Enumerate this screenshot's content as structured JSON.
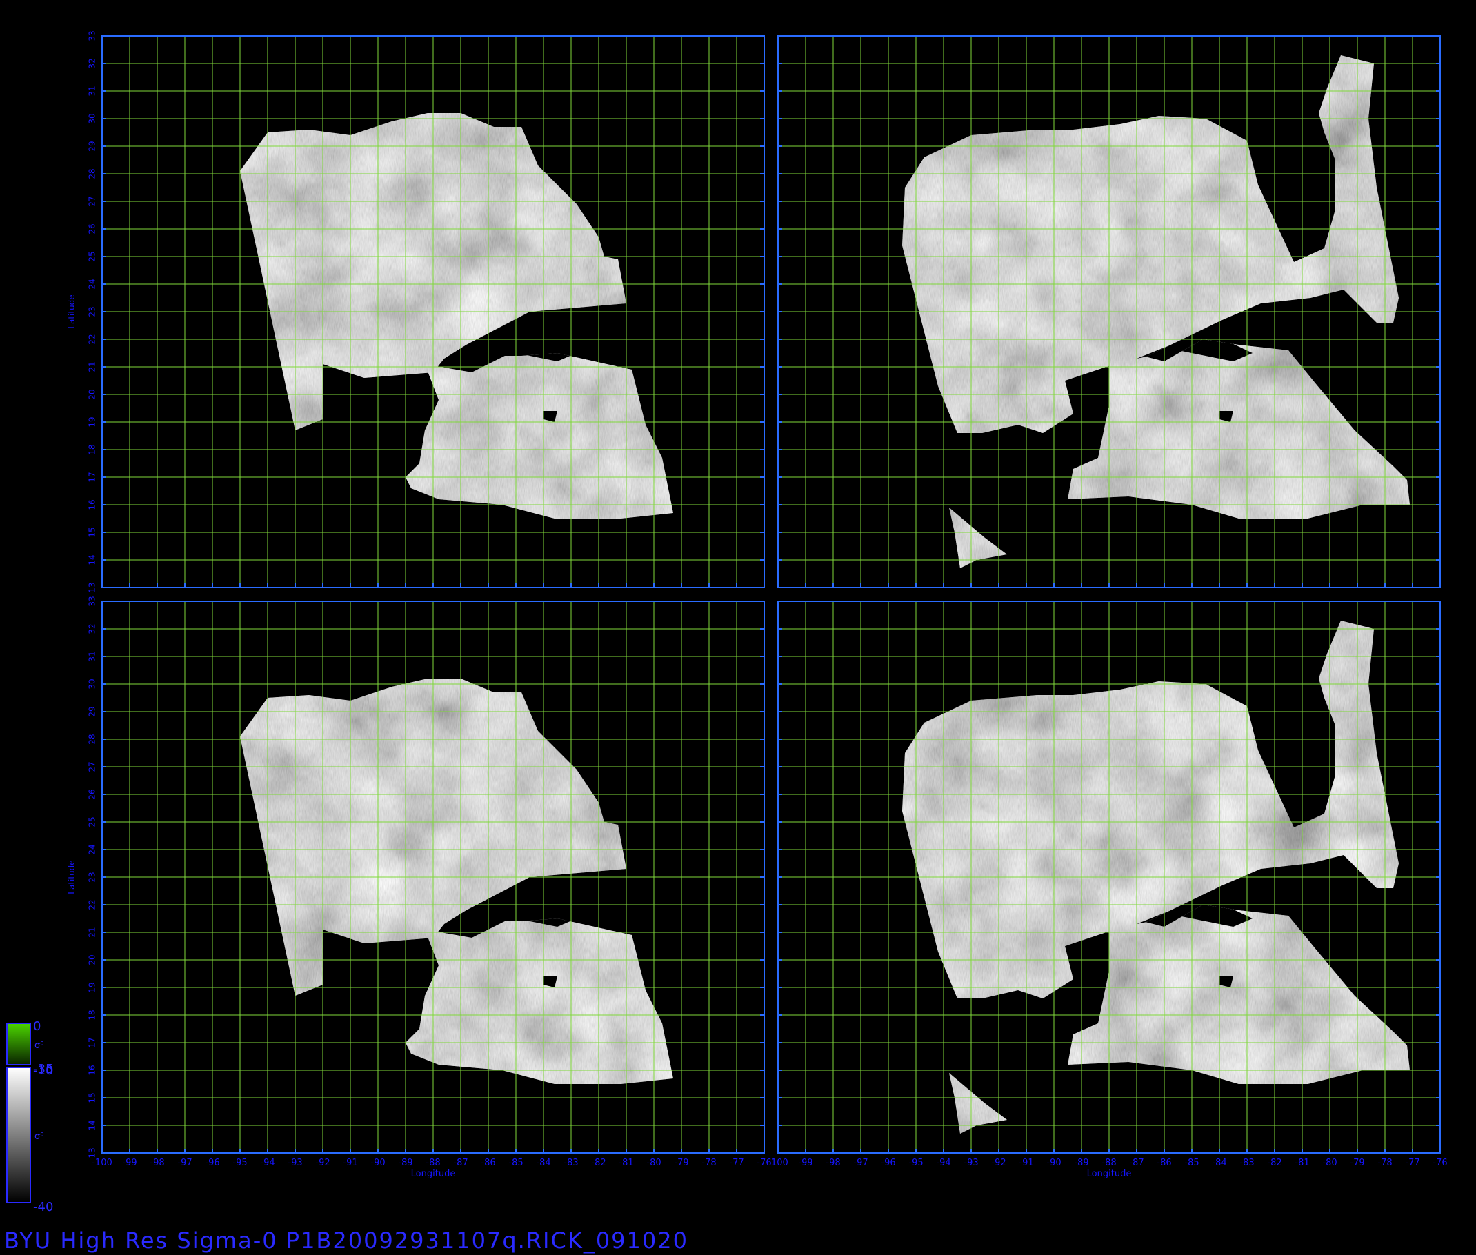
{
  "title": "BYU High Res Sigma-0 P1B20092931107q.RICK_091020",
  "axes": {
    "xlabel": "Longitude",
    "ylabel": "Latitude",
    "lon_range": [
      -100,
      -76
    ],
    "lat_range": [
      13,
      33
    ],
    "lon_ticks": [
      "-100",
      "-99",
      "-98",
      "-97",
      "-96",
      "-95",
      "-94",
      "-93",
      "-92",
      "-91",
      "-90",
      "-89",
      "-88",
      "-87",
      "-86",
      "-85",
      "-84",
      "-83",
      "-82",
      "-81",
      "-80",
      "-79",
      "-78",
      "-77",
      "-76"
    ],
    "lat_ticks": [
      "13",
      "14",
      "15",
      "16",
      "17",
      "18",
      "19",
      "20",
      "21",
      "22",
      "23",
      "24",
      "25",
      "26",
      "27",
      "28",
      "29",
      "30",
      "31",
      "32",
      "33"
    ],
    "grid": true,
    "grid_color": "#7fd83a",
    "frame_color": "#2a6cff",
    "tick_color": "#1515ff"
  },
  "colorbars": [
    {
      "top_label": "0",
      "bottom_label": "-35",
      "symbol": "σ⁰",
      "color_top": "#4cd600",
      "color_bottom": "#0a2200"
    },
    {
      "top_label": "-10",
      "bottom_label": "-40",
      "symbol": "σ⁰",
      "color_top": "#ffffff",
      "color_bottom": "#000000"
    }
  ],
  "panels": [
    {
      "id": "top-left",
      "variant": "a"
    },
    {
      "id": "top-right",
      "variant": "b"
    },
    {
      "id": "bottom-left",
      "variant": "a"
    },
    {
      "id": "bottom-right",
      "variant": "b"
    }
  ]
}
